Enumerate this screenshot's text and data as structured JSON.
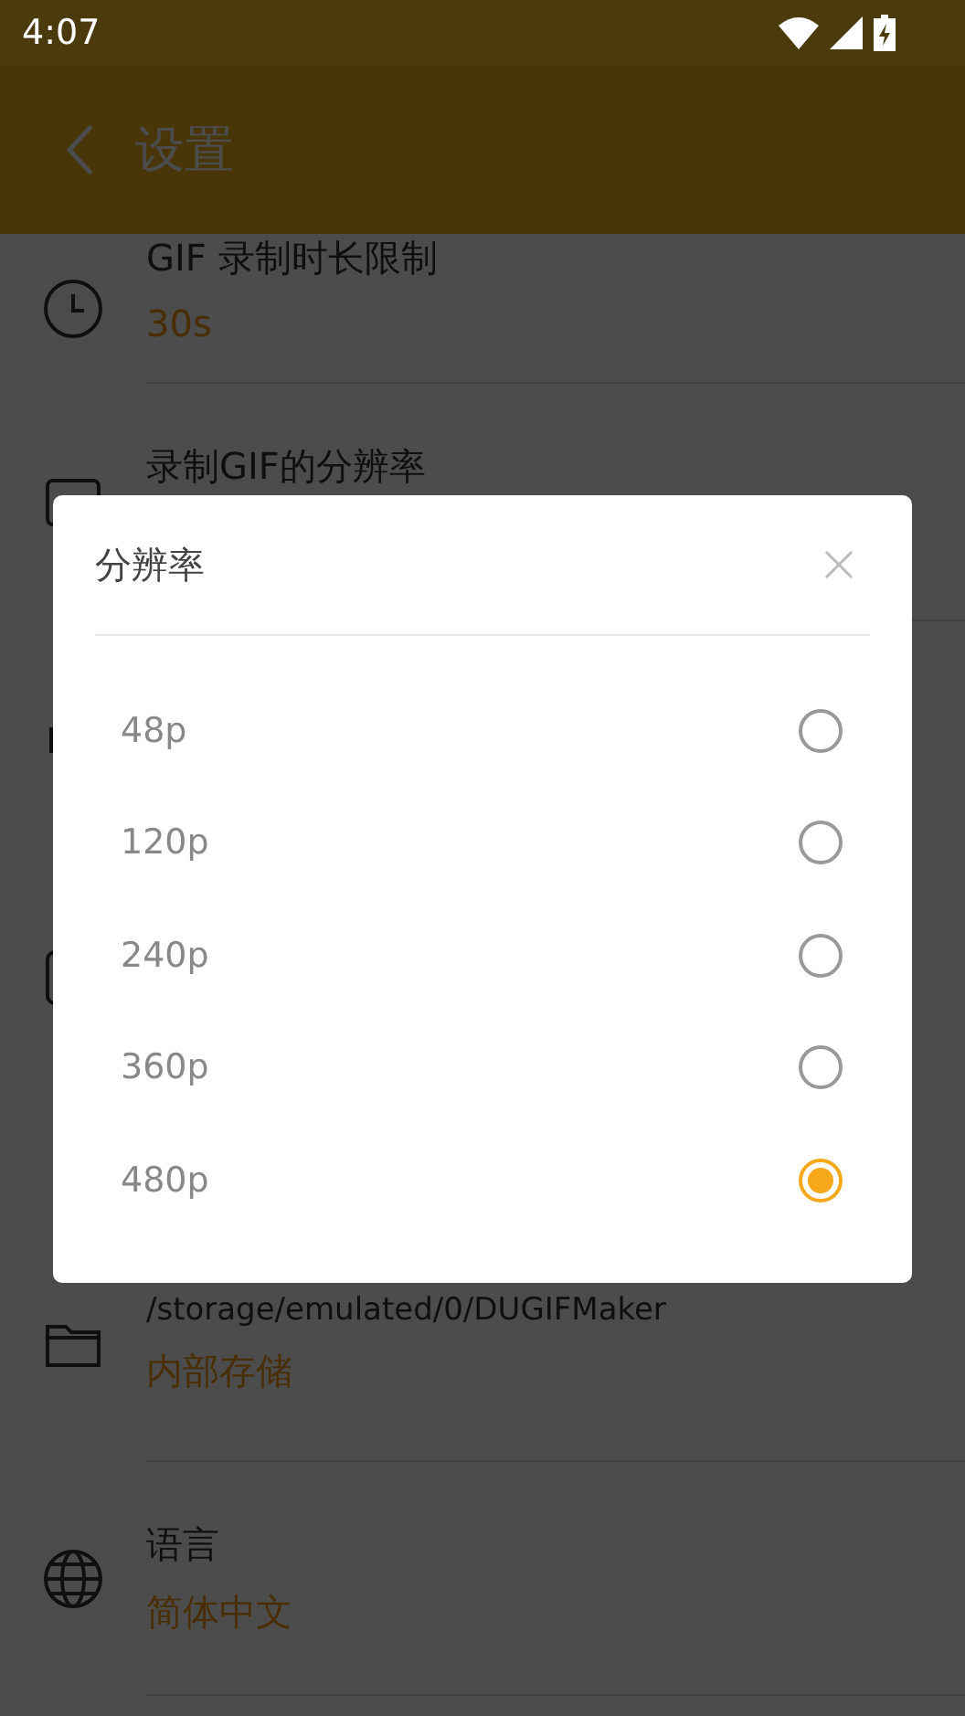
{
  "status_bar": {
    "time": "4:07"
  },
  "app_bar": {
    "title": "设置"
  },
  "settings": [
    {
      "kind": "clock",
      "title": "GIF 录制时长限制",
      "value": "30s"
    },
    {
      "kind": "image",
      "title": "录制GIF的分辨率"
    },
    {
      "kind": "folder",
      "title": "/storage/emulated/0/DUGIFMaker",
      "value": "内部存储"
    },
    {
      "kind": "globe",
      "title": "语言",
      "value": "简体中文"
    }
  ],
  "dialog": {
    "title": "分辨率",
    "options": [
      {
        "label": "48p",
        "selected": false
      },
      {
        "label": "120p",
        "selected": false
      },
      {
        "label": "240p",
        "selected": false
      },
      {
        "label": "360p",
        "selected": false
      },
      {
        "label": "480p",
        "selected": true
      }
    ]
  }
}
